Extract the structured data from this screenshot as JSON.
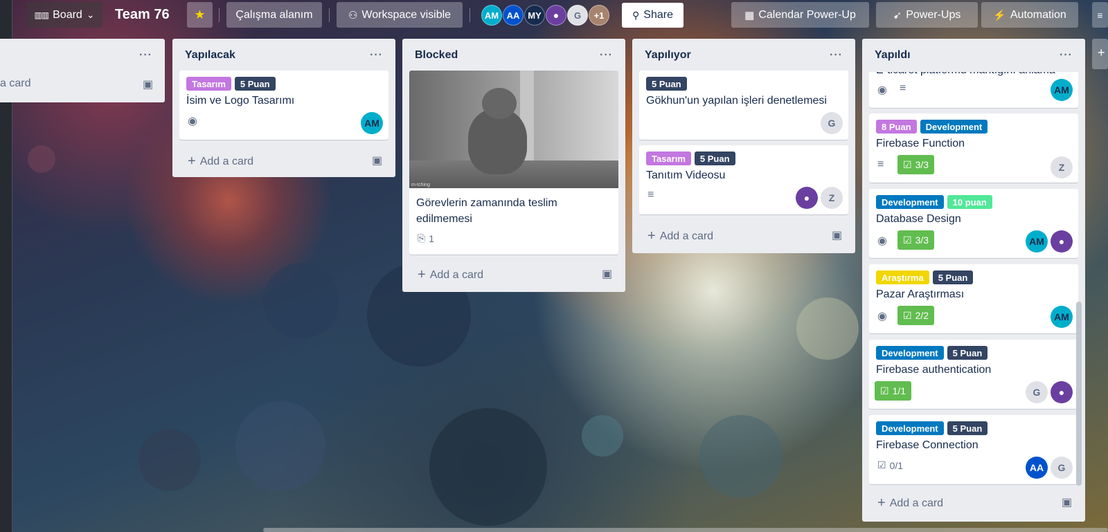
{
  "header": {
    "view_label": "Board",
    "board_title": "Team 76",
    "workspace_label": "Çalışma alanım",
    "visibility_label": "Workspace visible",
    "members": [
      "AM",
      "AA",
      "MY",
      "G"
    ],
    "members_more": "+1",
    "share_label": "Share",
    "calendar_label": "Calendar Power-Up",
    "powerups_label": "Power-Ups",
    "automation_label": "Automation"
  },
  "lists": {
    "partial": {
      "add_label": "a card"
    },
    "yapilacak": {
      "title": "Yapılacak",
      "cards": [
        {
          "labels": [
            "Tasarım",
            "5 Puan"
          ],
          "title": "İsim ve Logo Tasarımı",
          "members": [
            "AM"
          ]
        }
      ],
      "add_label": "Add a card"
    },
    "blocked": {
      "title": "Blocked",
      "cards": [
        {
          "title": "Görevlerin zamanında teslim edilmemesi",
          "attachments": "1",
          "cover": "gray-cat-photo",
          "watermark": "m-tching"
        }
      ],
      "add_label": "Add a card"
    },
    "yapiliyor": {
      "title": "Yapılıyor",
      "cards": [
        {
          "labels": [
            "5 Puan"
          ],
          "title": "Gökhun'un yapılan işleri denetlemesi",
          "members": [
            "G"
          ]
        },
        {
          "labels": [
            "Tasarım",
            "5 Puan"
          ],
          "title": "Tanıtım Videosu",
          "members": [
            "user",
            "Z"
          ]
        }
      ],
      "add_label": "Add a card"
    },
    "yapildi": {
      "title": "Yapıldı",
      "cards": [
        {
          "title": "E-ticaret platformu mantığını anlama",
          "members": [
            "AM"
          ]
        },
        {
          "labels": [
            "8 Puan",
            "Development"
          ],
          "title": "Firebase Function",
          "checklist": "3/3",
          "members": [
            "Z"
          ]
        },
        {
          "labels": [
            "Development",
            "10 puan"
          ],
          "title": "Database Design",
          "checklist": "3/3",
          "members": [
            "AM",
            "user"
          ]
        },
        {
          "labels": [
            "Araştırma",
            "5 Puan"
          ],
          "title": "Pazar Araştırması",
          "checklist": "2/2",
          "members": [
            "AM"
          ]
        },
        {
          "labels": [
            "Development",
            "5 Puan"
          ],
          "title": "Firebase authentication",
          "checklist": "1/1",
          "members": [
            "G",
            "user"
          ]
        },
        {
          "labels": [
            "Development",
            "5 Puan"
          ],
          "title": "Firebase Connection",
          "checklist": "0/1",
          "members": [
            "AA",
            "G"
          ]
        }
      ],
      "add_label": "Add a card"
    }
  },
  "colors": {
    "label_purple": "#c377e0",
    "label_navy": "#344563",
    "label_blue": "#0079bf",
    "label_green": "#51e898",
    "label_yellow": "#f2d600",
    "checklist_complete": "#61bd4f"
  }
}
